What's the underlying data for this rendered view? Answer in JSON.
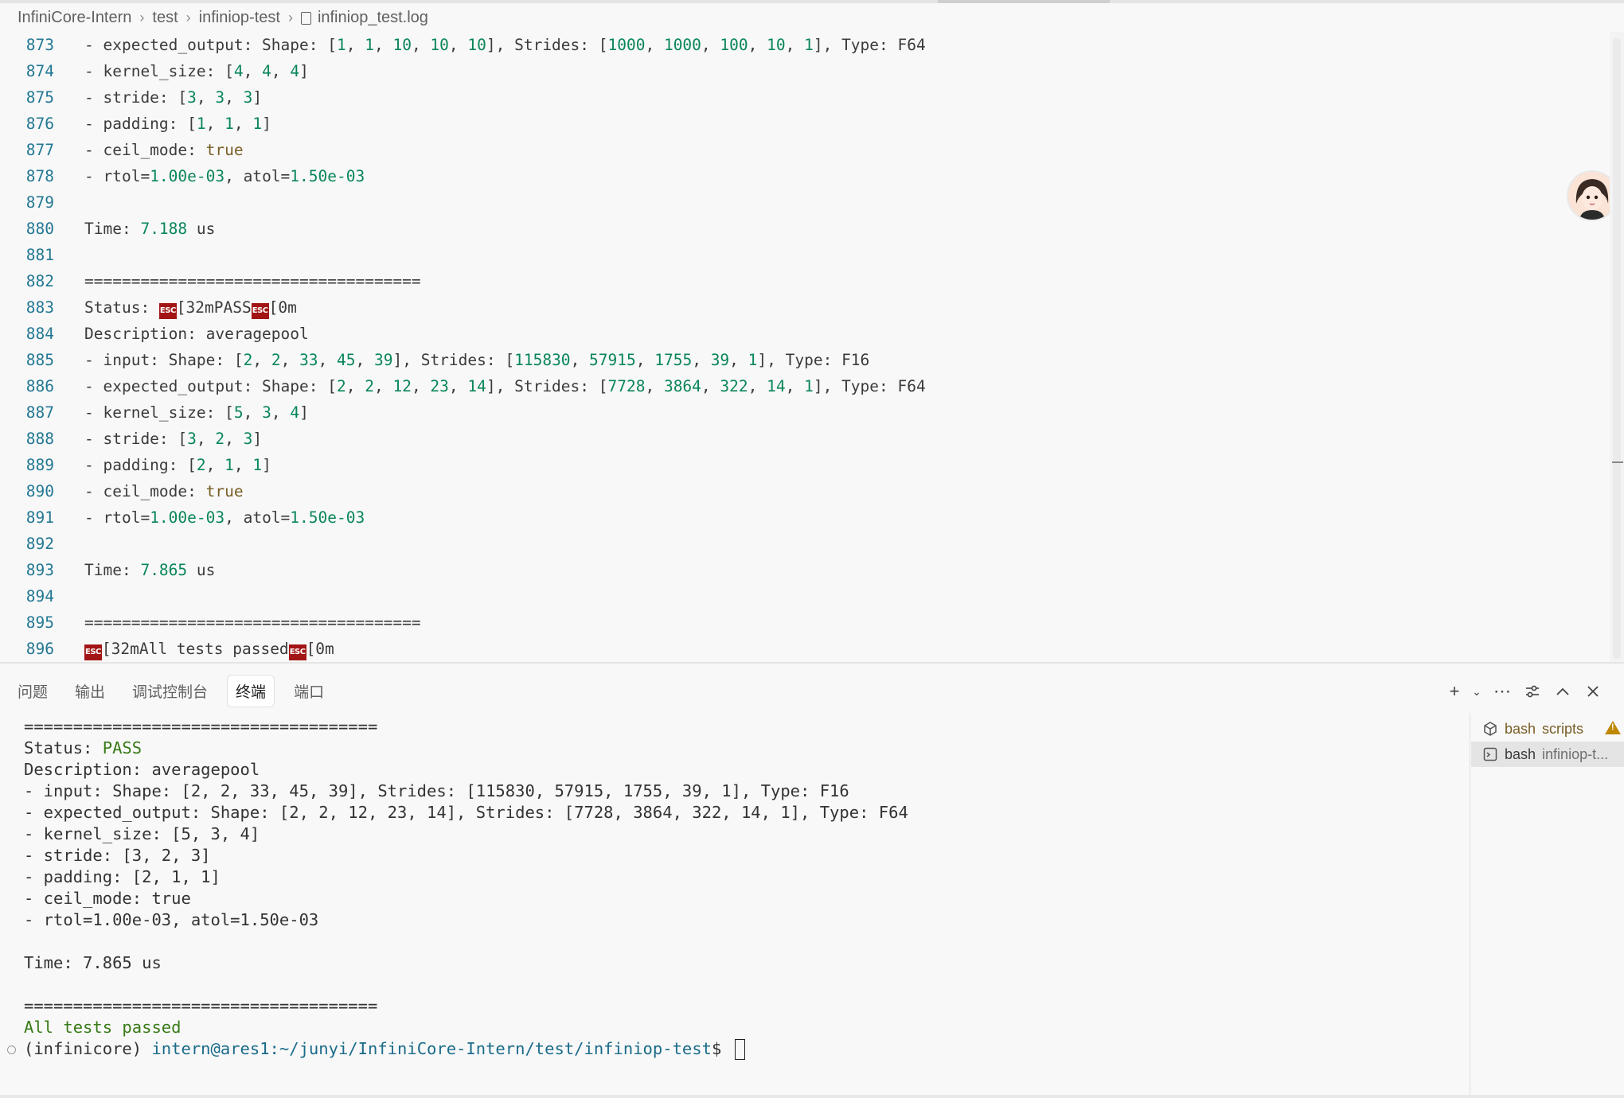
{
  "breadcrumb": [
    "InfiniCore-Intern",
    "test",
    "infiniop-test",
    "infiniop_test.log"
  ],
  "editor": {
    "lines": [
      {
        "n": "873",
        "t": "  - expected_output: Shape: [1, 1, 10, 10, 10], Strides: [1000, 1000, 100, 10, 1], Type: F64"
      },
      {
        "n": "874",
        "t": "  - kernel_size: [4, 4, 4]"
      },
      {
        "n": "875",
        "t": "  - stride: [3, 3, 3]"
      },
      {
        "n": "876",
        "t": "  - padding: [1, 1, 1]"
      },
      {
        "n": "877",
        "t": "  - ceil_mode: true"
      },
      {
        "n": "878",
        "t": "  - rtol=1.00e-03, atol=1.50e-03"
      },
      {
        "n": "879",
        "t": ""
      },
      {
        "n": "880",
        "t": "  Time: 7.188 us"
      },
      {
        "n": "881",
        "t": ""
      },
      {
        "n": "882",
        "t": "  ===================================="
      },
      {
        "n": "883",
        "t": "  Status: ␛[32mPASS␛[0m"
      },
      {
        "n": "884",
        "t": "  Description: averagepool"
      },
      {
        "n": "885",
        "t": "  - input: Shape: [2, 2, 33, 45, 39], Strides: [115830, 57915, 1755, 39, 1], Type: F16"
      },
      {
        "n": "886",
        "t": "  - expected_output: Shape: [2, 2, 12, 23, 14], Strides: [7728, 3864, 322, 14, 1], Type: F64"
      },
      {
        "n": "887",
        "t": "  - kernel_size: [5, 3, 4]"
      },
      {
        "n": "888",
        "t": "  - stride: [3, 2, 3]"
      },
      {
        "n": "889",
        "t": "  - padding: [2, 1, 1]"
      },
      {
        "n": "890",
        "t": "  - ceil_mode: true"
      },
      {
        "n": "891",
        "t": "  - rtol=1.00e-03, atol=1.50e-03"
      },
      {
        "n": "892",
        "t": ""
      },
      {
        "n": "893",
        "t": "  Time: 7.865 us"
      },
      {
        "n": "894",
        "t": ""
      },
      {
        "n": "895",
        "t": "  ===================================="
      },
      {
        "n": "896",
        "t": "  ␛[32mAll tests passed␛[0m"
      }
    ]
  },
  "panel": {
    "tabs": [
      "问题",
      "输出",
      "调试控制台",
      "终端",
      "端口"
    ],
    "active_tab": "终端"
  },
  "terminal": {
    "lines": [
      "====================================",
      "Status: PASS",
      "Description: averagepool",
      "- input: Shape: [2, 2, 33, 45, 39], Strides: [115830, 57915, 1755, 39, 1], Type: F16",
      "- expected_output: Shape: [2, 2, 12, 23, 14], Strides: [7728, 3864, 322, 14, 1], Type: F64",
      "- kernel_size: [5, 3, 4]",
      "- stride: [3, 2, 3]",
      "- padding: [2, 1, 1]",
      "- ceil_mode: true",
      "- rtol=1.00e-03, atol=1.50e-03",
      "",
      "Time: 7.865 us",
      "",
      "====================================",
      "All tests passed"
    ],
    "prompt_env": "(infinicore) ",
    "prompt_user": "intern@ares1:~/junyi/InfiniCore-Intern/test/infiniop-test",
    "prompt_symbol": "$ "
  },
  "terminal_list": [
    {
      "name": "bash",
      "detail": "scripts",
      "warning": true
    },
    {
      "name": "bash",
      "detail": "infiniop-t...",
      "selected": true
    }
  ],
  "colors": {
    "number": "#098658",
    "keyword": "#795e26",
    "line_number": "#237893",
    "pass_green": "#387a17",
    "esc_badge": "#a31515"
  }
}
